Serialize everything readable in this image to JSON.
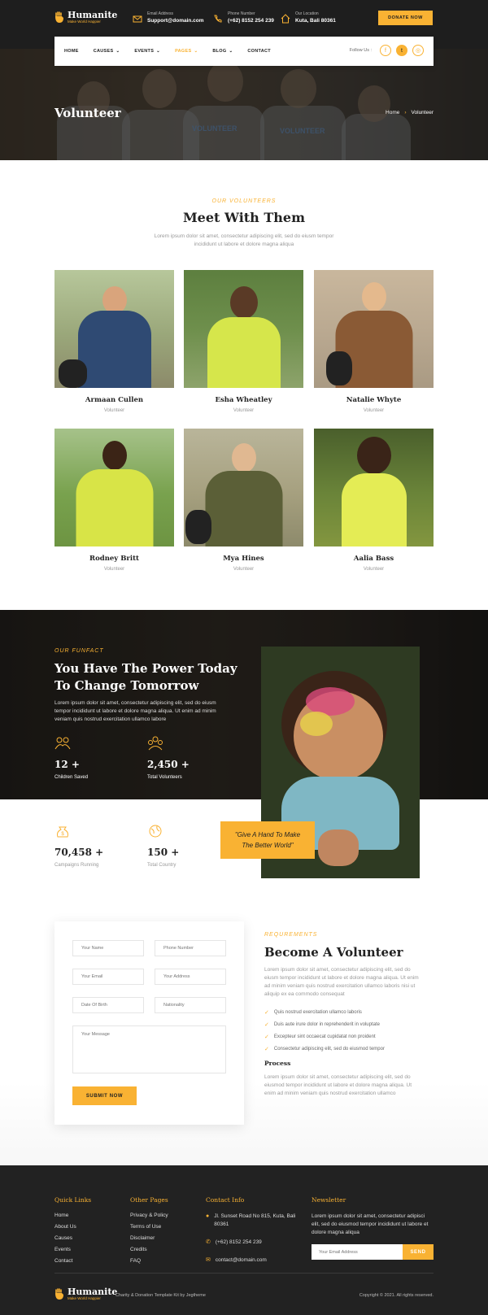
{
  "brand": {
    "name": "Humanite",
    "tagline": "Make World Happier"
  },
  "header": {
    "email": {
      "label": "Email Address",
      "value": "Support@domain.com"
    },
    "phone": {
      "label": "Phone Number",
      "value": "(+62) 8152 254 239"
    },
    "location": {
      "label": "Our Location",
      "value": "Kuta, Bali 80361"
    },
    "donate_label": "DONATE NOW"
  },
  "nav": {
    "items": [
      {
        "label": "HOME"
      },
      {
        "label": "CAUSES"
      },
      {
        "label": "EVENTS"
      },
      {
        "label": "PAGES"
      },
      {
        "label": "BLOG"
      },
      {
        "label": "CONTACT"
      }
    ],
    "follow_label": "Follow Us :"
  },
  "hero": {
    "title": "Volunteer",
    "breadcrumb": [
      "Home",
      "Volunteer"
    ],
    "shirt_text": "VOLUNTEER"
  },
  "team": {
    "subtitle": "OUR VOLUNTEERS",
    "title": "Meet With Them",
    "desc": "Lorem ipsum dolor sit amet, consectetur adipiscing elit, sed do eiusm tempor incididunt ut labore et dolore magna aliqua",
    "members": [
      {
        "name": "Armaan Cullen",
        "role": "Volunteer"
      },
      {
        "name": "Esha Wheatley",
        "role": "Volunteer"
      },
      {
        "name": "Natalie Whyte",
        "role": "Volunteer"
      },
      {
        "name": "Rodney Britt",
        "role": "Volunteer"
      },
      {
        "name": "Mya Hines",
        "role": "Volunteer"
      },
      {
        "name": "Aalia Bass",
        "role": "Volunteer"
      }
    ]
  },
  "funfact": {
    "subtitle": "OUR FUNFACT",
    "title_line1": "You Have The Power Today",
    "title_line2": "To Change Tomorrow",
    "desc": "Lorem ipsum dolor sit amet, consectetur adipiscing elit, sed do eiusm tempor incididunt ut labore et dolore magna aliqua. Ut enim ad minim veniam quis nostrud exercitation ullamco labore",
    "stats": [
      {
        "value": "12 +",
        "label": "Children Saved"
      },
      {
        "value": "2,450 +",
        "label": "Total Volunteers"
      },
      {
        "value": "70,458 +",
        "label": "Campaigns Running"
      },
      {
        "value": "150 +",
        "label": "Total Country"
      }
    ],
    "quote_line1": "\"Give A Hand To Make",
    "quote_line2": "The Better World\""
  },
  "form": {
    "name_ph": "Your Name",
    "phone_ph": "Phone Number",
    "email_ph": "Your Email",
    "address_ph": "Your Address",
    "dob_ph": "Date Of Birth",
    "nationality_ph": "Nationality",
    "message_ph": "Your Message",
    "submit_label": "SUBMIT NOW"
  },
  "become": {
    "subtitle": "REQUREMENTS",
    "title": "Become A Volunteer",
    "desc": "Lorem ipsum dolor sit amet, consectetur adipiscing elit, sed do eiusm tempor incididunt ut labore et dolore magna aliqua. Ut enim ad minim veniam quis nostrud exercitation ullamco laboris nisi ut aliquip ex ea commodo consequat",
    "checks": [
      "Quis nostrud exercitation ullamco laboris",
      "Duis aute irure dolor in reprehenderit in voluptate",
      "Excepteur sint occaecat cupidatat non proident",
      "Consectetur adipiscing elit, sed do eiusmod tempor"
    ],
    "process_title": "Process",
    "process_desc": "Lorem ipsum dolor sit amet, consectetur adipiscing elit, sed do eiusmod tempor incididunt ut labore et dolore magna aliqua. Ut enim ad minim veniam quis nostrud exercitation ullamco"
  },
  "footer": {
    "quick": {
      "title": "Quick Links",
      "links": [
        "Home",
        "About Us",
        "Causes",
        "Events",
        "Contact"
      ]
    },
    "other": {
      "title": "Other Pages",
      "links": [
        "Privacy & Policy",
        "Terms of Use",
        "Disclaimer",
        "Credits",
        "FAQ"
      ]
    },
    "contact": {
      "title": "Contact Info",
      "address_l1": "Jl. Sunset Road No 815, Kuta, Bali",
      "address_l2": "80361",
      "phone": "(+62) 8152 254 239",
      "email": "contact@domain.com"
    },
    "newsletter": {
      "title": "Newsletter",
      "desc": "Lorem ipsum dolor sit amet, consectetur adipisci elit, sed do eiusmod tempor incididunt ut labore et dolore magna aliqua",
      "placeholder": "Your Email Address",
      "send_label": "SEND"
    },
    "credit": "Charity & Donation Template Kit by Jegtheme",
    "copyright": "Copyright © 2021. All rights reserved."
  },
  "colors": {
    "accent": "#f9b233",
    "dark": "#1e1e1e"
  }
}
